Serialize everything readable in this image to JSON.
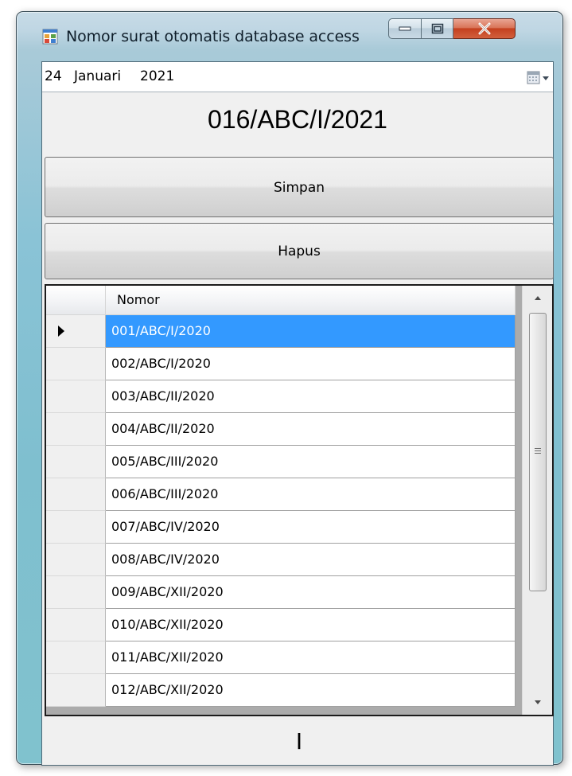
{
  "window": {
    "title": "Nomor surat otomatis database access",
    "icons": {
      "app": "form-app-icon",
      "minimize": "minimize-icon",
      "maximize": "maximize-icon",
      "close": "close-icon"
    }
  },
  "datepicker": {
    "day": "24",
    "month": "Januari",
    "year": "2021",
    "icon": "calendar-dropdown-icon"
  },
  "generated_number": "016/ABC/I/2021",
  "buttons": {
    "save": "Simpan",
    "delete": "Hapus"
  },
  "grid": {
    "column_header": "Nomor",
    "selected_row": 0,
    "rows": [
      "001/ABC/I/2020",
      "002/ABC/I/2020",
      "003/ABC/II/2020",
      "004/ABC/II/2020",
      "005/ABC/III/2020",
      "006/ABC/III/2020",
      "007/ABC/IV/2020",
      "008/ABC/IV/2020",
      "009/ABC/XII/2020",
      "010/ABC/XII/2020",
      "011/ABC/XII/2020",
      "012/ABC/XII/2020"
    ],
    "selection_color": "#3399ff"
  },
  "status_text": "I"
}
